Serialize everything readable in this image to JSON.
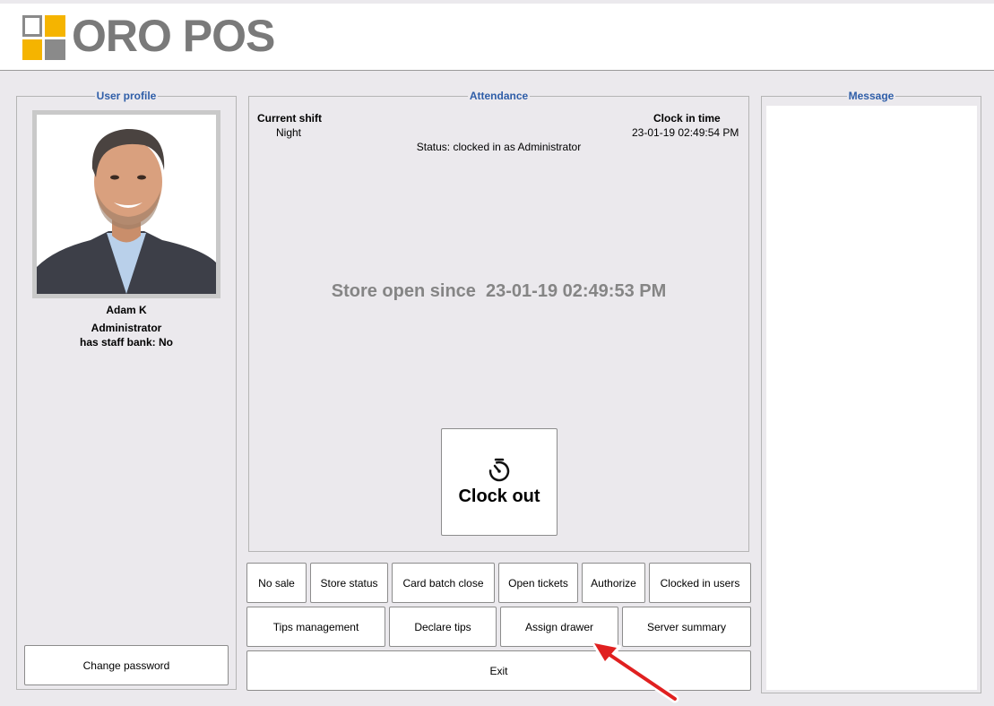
{
  "header": {
    "logo_text": "ORO POS",
    "logo_colors": [
      "#f5b400",
      "#8a8a8a"
    ]
  },
  "user_profile": {
    "legend": "User profile",
    "name": "Adam K",
    "role": "Administrator",
    "staff_bank": "has staff bank: No",
    "change_password_label": "Change password"
  },
  "attendance": {
    "legend": "Attendance",
    "current_shift_label": "Current shift",
    "current_shift_value": "Night",
    "clock_in_label": "Clock in time",
    "clock_in_value": "23-01-19 02:49:54 PM",
    "status": "Status: clocked in as Administrator",
    "store_open": "Store open since  23-01-19 02:49:53 PM",
    "clock_out_label": "Clock out",
    "clock_icon": "timer-icon"
  },
  "message": {
    "legend": "Message"
  },
  "actions_row1": [
    "No sale",
    "Store status",
    "Card batch close",
    "Open tickets",
    "Authorize",
    "Clocked in users"
  ],
  "actions_row2": [
    "Tips management",
    "Declare tips",
    "Assign drawer",
    "Server summary"
  ],
  "exit_label": "Exit",
  "colors": {
    "legend_blue": "#2f5ea8",
    "background": "#ebe9ed",
    "annotation_arrow": "#e02020"
  }
}
